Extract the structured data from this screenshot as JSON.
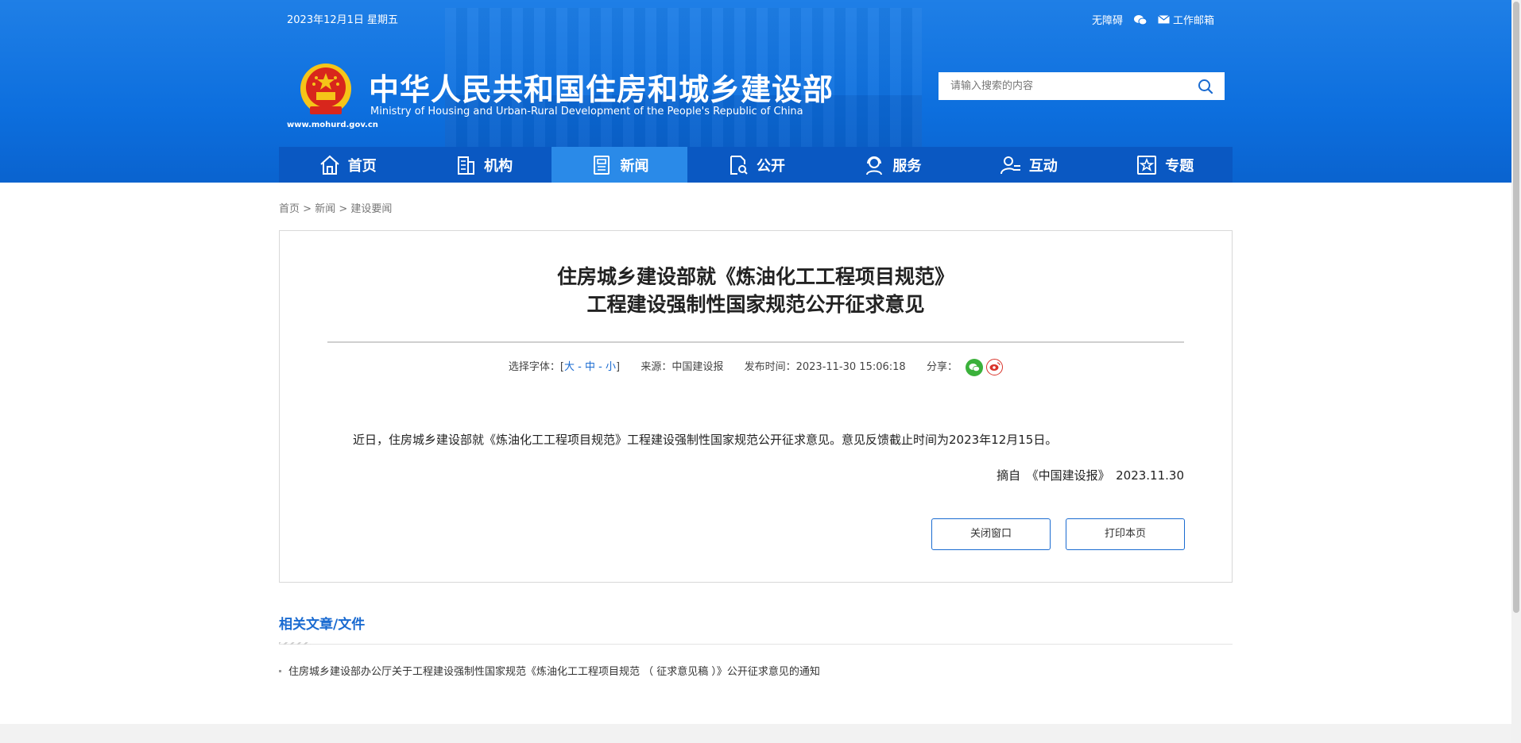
{
  "header": {
    "date": "2023年12月1日 星期五",
    "accessibility": "无障碍",
    "mail": "工作邮箱",
    "title_cn": "中华人民共和国住房和城乡建设部",
    "title_en": "Ministry of Housing and Urban-Rural Development of the People's Republic of China",
    "site_url": "www.mohurd.gov.cn",
    "search_placeholder": "请输入搜索的内容"
  },
  "nav": {
    "items": [
      {
        "label": "首页"
      },
      {
        "label": "机构"
      },
      {
        "label": "新闻"
      },
      {
        "label": "公开"
      },
      {
        "label": "服务"
      },
      {
        "label": "互动"
      },
      {
        "label": "专题"
      }
    ],
    "active_index": 2
  },
  "breadcrumb": {
    "home": "首页",
    "sep": ">",
    "news": "新闻",
    "section": "建设要闻"
  },
  "article": {
    "title_line1": "住房城乡建设部就《炼油化工工程项目规范》",
    "title_line2": "工程建设强制性国家规范公开征求意见",
    "font_label": "选择字体：[",
    "font_large": "大",
    "font_dash": "-",
    "font_medium": "中",
    "font_small": "小",
    "font_close": "]",
    "source": "来源：中国建设报",
    "publish_time": "发布时间：2023-11-30 15:06:18",
    "share_label": "分享：",
    "body": "近日，住房城乡建设部就《炼油化工工程项目规范》工程建设强制性国家规范公开征求意见。意见反馈截止时间为2023年12月15日。",
    "excerpt": "摘自　《中国建设报》　2023.11.30",
    "close_button": "关闭窗口",
    "print_button": "打印本页"
  },
  "related": {
    "title": "相关文章/文件",
    "items": [
      "住房城乡建设部办公厅关于工程建设强制性国家规范《炼油化工工程项目规范 （ 征求意见稿 ）》公开征求意见的通知"
    ]
  },
  "colors": {
    "header_blue": "#0d6fde",
    "nav_blue": "#0a58c2",
    "nav_active": "#2a8ae8",
    "link_blue": "#1a6bd1",
    "wechat_green": "#3bb13b",
    "weibo_red": "#d9342b"
  }
}
